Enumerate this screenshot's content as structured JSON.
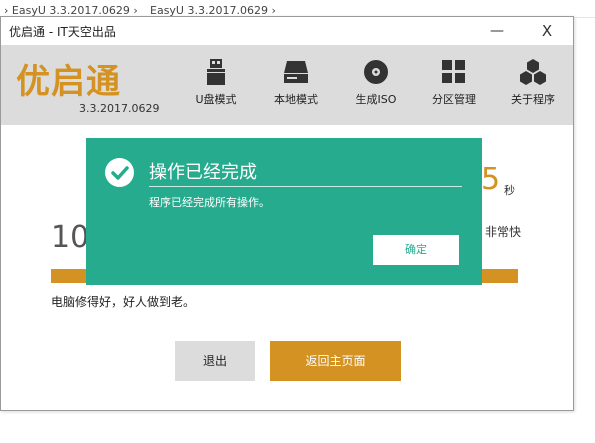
{
  "background": {
    "crumb_1": "› EasyU 3.3.2017.0629  ›",
    "crumb_2": "EasyU 3.3.2017.0629  ›"
  },
  "window": {
    "title": "优启通 - IT天空出品",
    "minimize_label": "—",
    "close_label": "X"
  },
  "header": {
    "logo_text": "优启通",
    "version": "3.3.2017.0629"
  },
  "toolbar": {
    "items": [
      {
        "label": "U盘模式",
        "icon": "usb-drive-icon"
      },
      {
        "label": "本地模式",
        "icon": "hard-disk-icon"
      },
      {
        "label": "生成ISO",
        "icon": "disc-icon"
      },
      {
        "label": "分区管理",
        "icon": "partition-grid-icon"
      },
      {
        "label": "关于程序",
        "icon": "hexagon-cluster-icon"
      }
    ]
  },
  "content": {
    "big_number": "10",
    "right_digit": "5",
    "seconds_unit": "秒",
    "right_text": "非常快",
    "progress": 1.0,
    "slogan": "电脑修得好，好人做到老。",
    "exit_button": "退出",
    "home_button": "返回主页面"
  },
  "dialog": {
    "title": "操作已经完成",
    "message": "程序已经完成所有操作。",
    "ok_label": "确定",
    "icon": "check-circle-icon"
  },
  "colors": {
    "accent": "#d39222",
    "dialog_bg": "#26ab8e",
    "toolbar_bg": "#dcdcdc"
  }
}
